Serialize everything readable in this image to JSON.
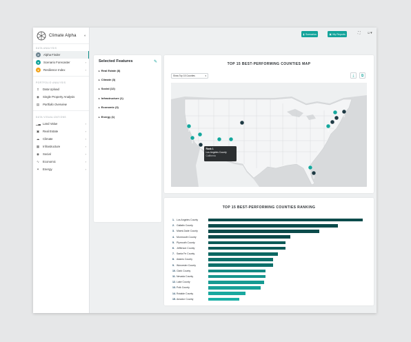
{
  "app": {
    "title": "Climate Alpha",
    "collapse_icon": "collapse-sidebar-icon"
  },
  "sidebar": {
    "section_main": "Data Analysis",
    "main_items": [
      {
        "label": "Alpha Finder",
        "color": "#6e8591",
        "icon": "compass-icon"
      },
      {
        "label": "Scenario Forecaster",
        "color": "#13a39a",
        "icon": "forecast-icon"
      },
      {
        "label": "Resilience Index",
        "color": "#f2a31b",
        "icon": "shield-icon"
      }
    ],
    "section_portfolio": "Portfolio Analysis",
    "portfolio_items": [
      {
        "label": "Data Upload",
        "icon": "upload-icon"
      },
      {
        "label": "Single Property Analysis",
        "icon": "target-icon"
      },
      {
        "label": "Portfolio Overview",
        "icon": "overview-icon"
      }
    ],
    "section_viz": "Data Visualizations",
    "viz_items": [
      {
        "label": "Land Value",
        "icon": "bar-chart-icon"
      },
      {
        "label": "Real Estate",
        "icon": "building-icon"
      },
      {
        "label": "Climate",
        "icon": "cloud-icon"
      },
      {
        "label": "Infrastructure",
        "icon": "grid-icon"
      },
      {
        "label": "Social",
        "icon": "globe-icon"
      },
      {
        "label": "Economic",
        "icon": "trend-icon"
      },
      {
        "label": "Energy",
        "icon": "bolt-icon"
      }
    ]
  },
  "topbar": {
    "scenarios_label": "Scenarios",
    "reports_label": "My Reports"
  },
  "features": {
    "title": "Selected Features",
    "items": [
      "Real Estate (8)",
      "Climate (3)",
      "Social (12)",
      "Infrastructure (1)",
      "Economic (3)",
      "Energy (1)"
    ]
  },
  "map": {
    "title": "TOP 15 BEST-PERFORMING COUNTIES MAP",
    "select_value": "Show Top 15 Counties",
    "tooltip": {
      "rank": "Rank 1",
      "county": "Los Angeles County",
      "state": "California"
    },
    "colors": {
      "land": "#f4f5f6",
      "water": "#d8dadc",
      "top_marker": "#1f3a44",
      "marker": "#15a79d"
    }
  },
  "ranking": {
    "title": "TOP 15 BEST-PERFORMING COUNTIES RANKING",
    "rows": [
      {
        "rank": "1.",
        "name": "Los Angeles County",
        "value": 100,
        "color": "#0b4b4b"
      },
      {
        "rank": "2.",
        "name": "Gallatin County",
        "value": 84,
        "color": "#0b4b4b"
      },
      {
        "rank": "3.",
        "name": "Miami-Dade County",
        "value": 72,
        "color": "#0b4b4b"
      },
      {
        "rank": "4.",
        "name": "Monmouth County",
        "value": 53,
        "color": "#0b4b4b"
      },
      {
        "rank": "5.",
        "name": "Plymouth County",
        "value": 50,
        "color": "#0c5a57"
      },
      {
        "rank": "6.",
        "name": "Jefferson County",
        "value": 50,
        "color": "#0c5a57"
      },
      {
        "rank": "7.",
        "name": "Santa Fe County",
        "value": 45,
        "color": "#0c6762"
      },
      {
        "rank": "8.",
        "name": "Adams County",
        "value": 42,
        "color": "#0d6f69"
      },
      {
        "rank": "9.",
        "name": "Worcester County",
        "value": 42,
        "color": "#0d6f69"
      },
      {
        "rank": "10.",
        "name": "Clark County",
        "value": 37,
        "color": "#138a83"
      },
      {
        "rank": "11.",
        "name": "Nevada County",
        "value": 37,
        "color": "#15958d"
      },
      {
        "rank": "12.",
        "name": "Lake County",
        "value": 36,
        "color": "#159a92"
      },
      {
        "rank": "13.",
        "name": "Polk County",
        "value": 34,
        "color": "#17a098"
      },
      {
        "rank": "14.",
        "name": "Rotalde County",
        "value": 24,
        "color": "#19a89f"
      },
      {
        "rank": "15.",
        "name": "Amador County",
        "value": 20,
        "color": "#1bb0a6"
      }
    ]
  }
}
